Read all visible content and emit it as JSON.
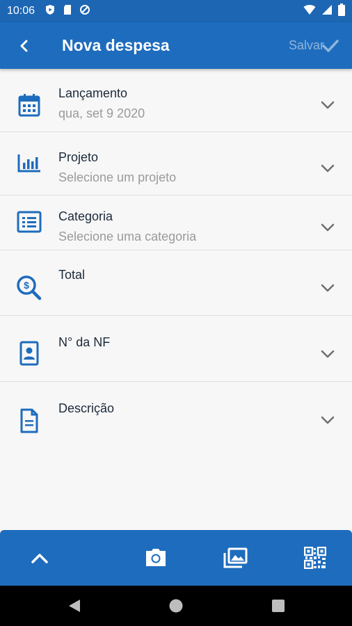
{
  "status_bar": {
    "time": "10:06"
  },
  "app_bar": {
    "title": "Nova despesa",
    "save_label": "Salvar"
  },
  "fields": [
    {
      "label": "Lançamento",
      "value": "qua, set 9 2020",
      "icon": "calendar-icon"
    },
    {
      "label": "Projeto",
      "value": "Selecione um projeto",
      "icon": "bar-chart-icon"
    },
    {
      "label": "Categoria",
      "value": "Selecione uma categoria",
      "icon": "list-icon"
    },
    {
      "label": "Total",
      "value": "",
      "icon": "money-search-icon"
    },
    {
      "label": "N° da NF",
      "value": "",
      "icon": "id-badge-icon"
    },
    {
      "label": "Descrição",
      "value": "",
      "icon": "document-icon"
    }
  ],
  "bottom_bar": {
    "icons": [
      "chevron-up-icon",
      "camera-icon",
      "gallery-icon",
      "qr-code-icon"
    ]
  },
  "colors": {
    "primary": "#1e6cbd",
    "status_bar": "#1d66b3",
    "icon": "#1e6cbd",
    "background": "#f7f7f7"
  }
}
